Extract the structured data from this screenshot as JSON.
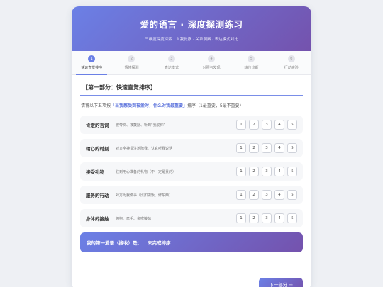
{
  "header": {
    "title": "爱的语言 · 深度探测练习",
    "subtitle": "三维度深度探索：自我觉察 · 关系洞察 · 表达模式对比"
  },
  "steps": [
    {
      "num": "1",
      "label": "快速直觉排序",
      "active": true
    },
    {
      "num": "2",
      "label": "情境探测",
      "active": false
    },
    {
      "num": "3",
      "label": "表达模式",
      "active": false
    },
    {
      "num": "4",
      "label": "对照与发现",
      "active": false
    },
    {
      "num": "5",
      "label": "缺位诊断",
      "active": false
    },
    {
      "num": "6",
      "label": "行动实验",
      "active": false
    }
  ],
  "section": {
    "title": "【第一部分：快速直觉排序】",
    "instr_prefix": "请将以下五项按",
    "instr_highlight": "「当我感受到被爱时，什么对我最重要」",
    "instr_suffix": "排序（1最重要，5最不重要）"
  },
  "languages": [
    {
      "name": "肯定的言词",
      "desc": "被夸奖、被鼓励、听到“我爱你”"
    },
    {
      "name": "精心的时刻",
      "desc": "对方全神贯注地陪我、认真听我说话"
    },
    {
      "name": "接受礼物",
      "desc": "收到用心准备的礼物（不一定是贵的）"
    },
    {
      "name": "服务的行动",
      "desc": "对方为我做事（比如做饭、修东西）"
    },
    {
      "name": "身体的接触",
      "desc": "拥抱、牵手、亲密接触"
    }
  ],
  "ranks": [
    "1",
    "2",
    "3",
    "4",
    "5"
  ],
  "result": {
    "label": "我的第一爱语（接收）是：",
    "value": "未完成排序"
  },
  "next_button": "下一部分 →",
  "colors": {
    "accent": "#6b80e6",
    "accent_dark": "#7452ad"
  }
}
